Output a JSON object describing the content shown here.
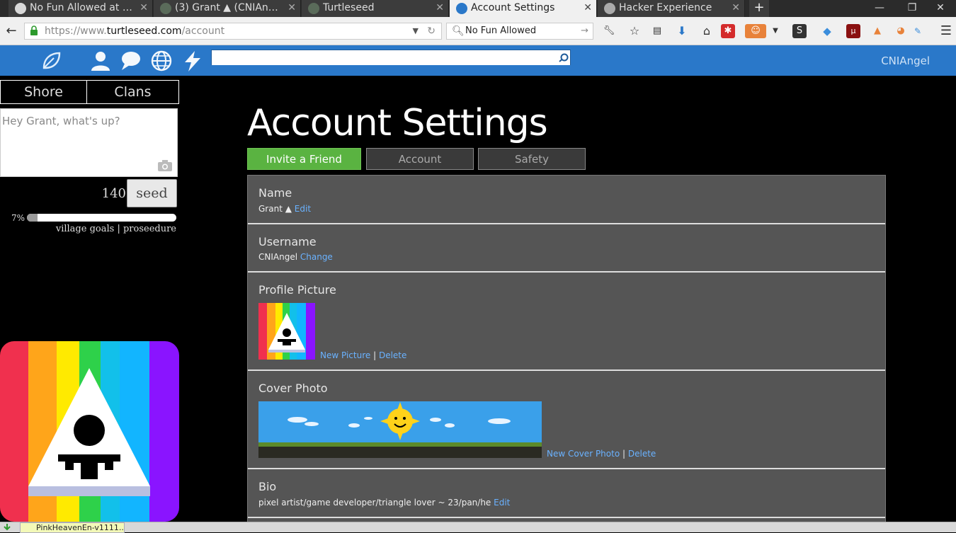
{
  "browser": {
    "tabs": [
      {
        "title": "No Fun Allowed at Du...",
        "icon_color": "#d9d9d9"
      },
      {
        "title": "(3) Grant ▲ (CNIAngel...",
        "icon_color": "#5a6b5a"
      },
      {
        "title": "Turtleseed",
        "icon_color": "#5a6b5a"
      },
      {
        "title": "Account Settings",
        "icon_color": "#2a78c9"
      },
      {
        "title": "Hacker Experience",
        "icon_color": "#aaaaaa"
      }
    ],
    "active_tab": 3,
    "new_tab_label": "+",
    "url_prefix": "https://www.",
    "url_domain": "turtleseed.com",
    "url_path": "/account",
    "search_value": "No Fun Allowed"
  },
  "site": {
    "search_placeholder": "",
    "username": "CNIAngel"
  },
  "sidebar": {
    "tabs": [
      "Shore",
      "Clans"
    ],
    "composer_placeholder": "Hey Grant, what's up?",
    "char_count": "140",
    "seed_label": "seed",
    "progress_percent_label": "7%",
    "progress_value": 0.07,
    "goals_link": "village goals",
    "goals_sep": " | ",
    "proseedure_link": "proseedure"
  },
  "main": {
    "title": "Account Settings",
    "tabs": {
      "invite": "Invite a Friend",
      "account": "Account",
      "safety": "Safety"
    },
    "sections": {
      "name": {
        "label": "Name",
        "value": "Grant ▲",
        "action": "Edit"
      },
      "username": {
        "label": "Username",
        "value": "CNIAngel",
        "action": "Change"
      },
      "profile_picture": {
        "label": "Profile Picture",
        "action1": "New Picture",
        "sep": "|",
        "action2": "Delete"
      },
      "cover_photo": {
        "label": "Cover Photo",
        "action1": "New Cover Photo",
        "sep": "|",
        "action2": "Delete"
      },
      "bio": {
        "label": "Bio",
        "value": "pixel artist/game developer/triangle lover ~ 23/pan/he",
        "action": "Edit"
      }
    }
  },
  "downloads": {
    "item": "PinkHeavenEn-v1111..."
  },
  "colors": {
    "header_blue": "#2a78c9",
    "invite_green": "#5ab341",
    "link_blue": "#6ab2ff",
    "panel_gray": "#555555"
  }
}
